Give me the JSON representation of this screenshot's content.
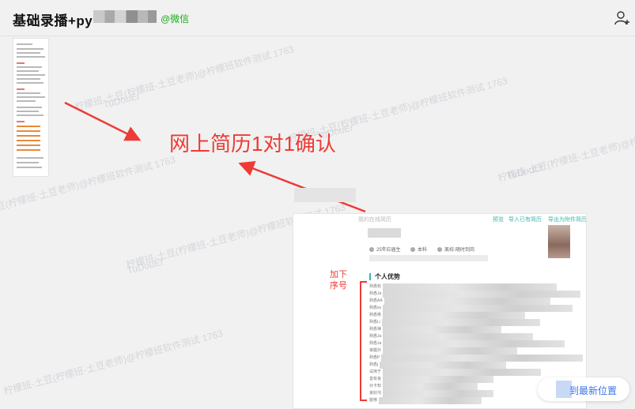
{
  "header": {
    "chat_title": "基础录播+py",
    "wx_tag": "@微信",
    "add_member_icon": "add-person-icon"
  },
  "note": {
    "text": "网上简历1对1确认",
    "color": "#ee3b35"
  },
  "watermark": {
    "line1": "柠檬班-土豆(柠檬班-土豆老师)@柠檬班软件测试 1763",
    "line2": "TuDouEr"
  },
  "resume": {
    "top_label": "我的在线简历",
    "links": [
      "预览",
      "导入已有简历",
      "导出为附件简历"
    ],
    "meta": [
      "25年应届生",
      "本科",
      "离校-随时到岗"
    ],
    "section_title": "个人优势",
    "hint": "加下\n序号",
    "rows": [
      "熟悉软",
      "熟悉Ja",
      "熟悉AA",
      "熟悉ss",
      "熟悉移",
      "熟悉Li",
      "熟悉禅",
      "熟悉Ja",
      "熟悉Ja",
      "掌握外",
      "熟悉P",
      "熟悉j",
      "试用于",
      "善有良",
      "对卡知",
      "良好沟",
      "能够"
    ]
  },
  "jump_button": {
    "label": "到最新位置"
  },
  "colors": {
    "accent": "#ee3b35",
    "wechat_green": "#1aad19",
    "link_blue": "#3a75e6",
    "teal": "#3fb3b0"
  }
}
